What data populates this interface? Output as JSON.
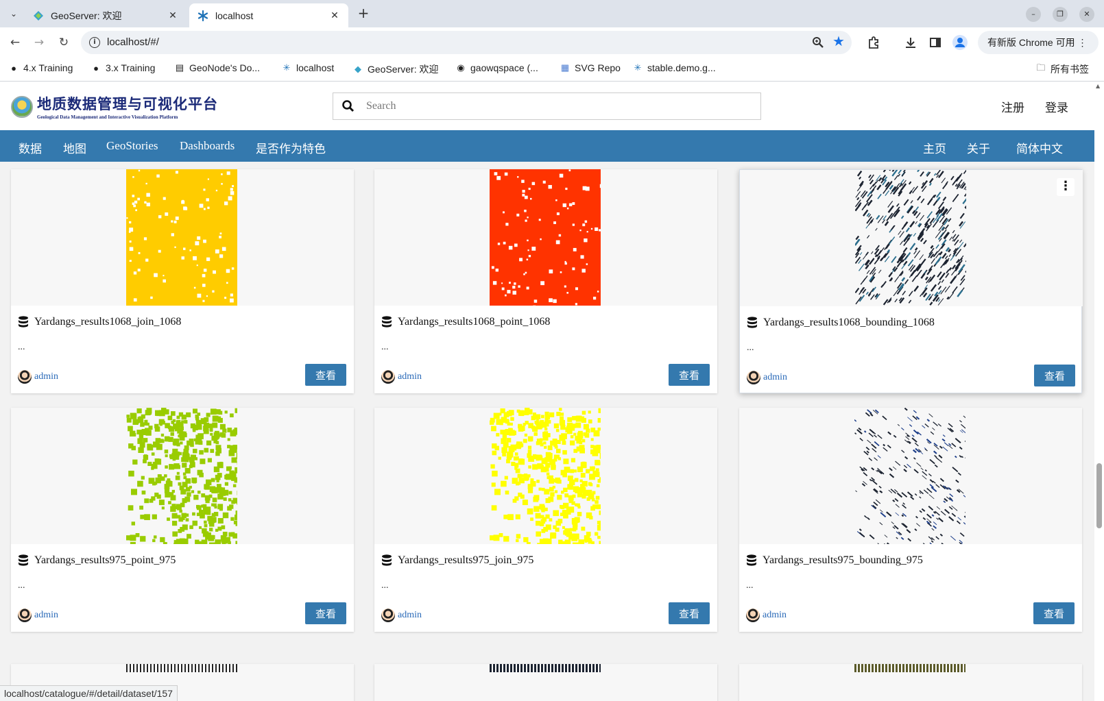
{
  "browser": {
    "tabs": [
      {
        "title": "GeoServer: 欢迎",
        "close": "✕",
        "active": false
      },
      {
        "title": "localhost",
        "close": "✕",
        "active": true
      }
    ],
    "tab_search_glyph": "⌄",
    "new_tab_glyph": "+",
    "window_controls": {
      "minimize": "–",
      "maximize": "❐",
      "close": "✕"
    },
    "url": "localhost/#/",
    "update_button": "有新版 Chrome 可用 ⋮",
    "bookmarks": [
      {
        "label": "4.x Training",
        "icon": "globe-icon"
      },
      {
        "label": "3.x Training",
        "icon": "globe-icon"
      },
      {
        "label": "GeoNode's Do...",
        "icon": "doc-icon"
      },
      {
        "label": "localhost",
        "icon": "geonode-icon"
      },
      {
        "label": "GeoServer: 欢迎",
        "icon": "geoserver-icon"
      },
      {
        "label": "gaowqspace (...",
        "icon": "github-icon"
      },
      {
        "label": "SVG Repo",
        "icon": "svgrepo-icon"
      },
      {
        "label": "stable.demo.g...",
        "icon": "geonode-icon"
      }
    ],
    "all_bookmarks": "所有书签",
    "status_url": "localhost/catalogue/#/detail/dataset/157"
  },
  "header": {
    "logo_cn": "地质数据管理与可视化平台",
    "logo_en": "Geological Data Management and Interactive Visualization Platform",
    "search_placeholder": "Search",
    "register": "注册",
    "login": "登录"
  },
  "nav": {
    "left": [
      "数据",
      "地图",
      "GeoStories",
      "Dashboards",
      "是否作为特色"
    ],
    "right": [
      "主页",
      "关于",
      "简体中文"
    ]
  },
  "cards": [
    {
      "title": "Yardangs_results1068_join_1068",
      "desc": "...",
      "owner": "admin",
      "button": "查看",
      "color": "#ffcc00",
      "pattern": "dense"
    },
    {
      "title": "Yardangs_results1068_point_1068",
      "desc": "...",
      "owner": "admin",
      "button": "查看",
      "color": "#ff3300",
      "pattern": "dense"
    },
    {
      "title": "Yardangs_results1068_bounding_1068",
      "desc": "...",
      "owner": "admin",
      "button": "查看",
      "color": "#1c2330",
      "pattern": "streaks",
      "menu": "⋮"
    },
    {
      "title": "Yardangs_results975_point_975",
      "desc": "...",
      "owner": "admin",
      "button": "查看",
      "color": "#99cc00",
      "pattern": "diagonal"
    },
    {
      "title": "Yardangs_results975_join_975",
      "desc": "...",
      "owner": "admin",
      "button": "查看",
      "color": "#ffff00",
      "pattern": "diagonal"
    },
    {
      "title": "Yardangs_results975_bounding_975",
      "desc": "...",
      "owner": "admin",
      "button": "查看",
      "color": "#1c2330",
      "pattern": "sparse"
    }
  ]
}
